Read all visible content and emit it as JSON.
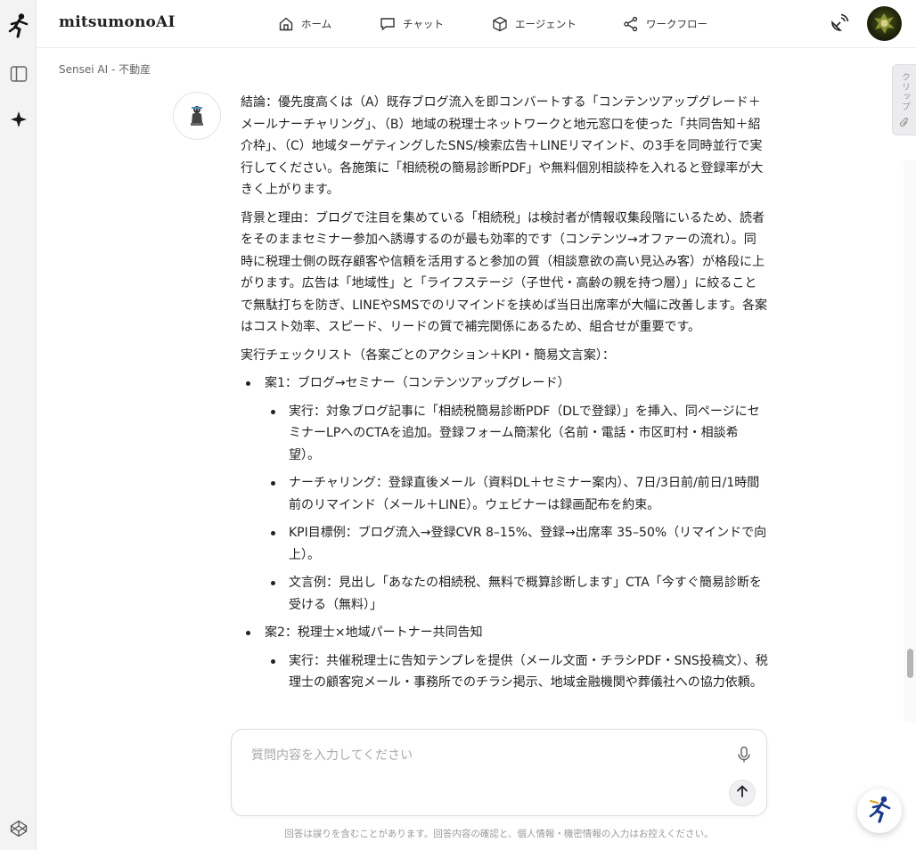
{
  "app": {
    "name": "mitsumonoAI"
  },
  "nav": [
    {
      "label": "ホーム",
      "icon": "home-icon"
    },
    {
      "label": "チャット",
      "icon": "chat-icon"
    },
    {
      "label": "エージェント",
      "icon": "cube-icon"
    },
    {
      "label": "ワークフロー",
      "icon": "share-nodes-icon"
    }
  ],
  "breadcrumb": "Sensei AI - 不動産",
  "clip_tab": {
    "label": "クリップ"
  },
  "message": {
    "p1": "結論：優先度高くは（A）既存ブログ流入を即コンバートする「コンテンツアップグレード＋メールナーチャリング」、（B）地域の税理士ネットワークと地元窓口を使った「共同告知＋紹介枠」、（C）地域ターゲティングしたSNS/検索広告＋LINEリマインド、の3手を同時並行で実行してください。各施策に「相続税の簡易診断PDF」や無料個別相談枠を入れると登録率が大きく上がります。",
    "p2": "背景と理由：ブログで注目を集めている「相続税」は検討者が情報収集段階にいるため、読者をそのままセミナー参加へ誘導するのが最も効率的です（コンテンツ→オファーの流れ）。同時に税理士側の既存顧客や信頼を活用すると参加の質（相談意欲の高い見込み客）が格段に上がります。広告は「地域性」と「ライフステージ（子世代・高齢の親を持つ層）」に絞ることで無駄打ちを防ぎ、LINEやSMSでのリマインドを挟めば当日出席率が大幅に改善します。各案はコスト効率、スピード、リードの質で補完関係にあるため、組合せが重要です。",
    "p3": "実行チェックリスト（各案ごとのアクション＋KPI・簡易文言案）：",
    "plan1": {
      "title": "案1：ブログ→セミナー（コンテンツアップグレード）",
      "items": [
        "実行：対象ブログ記事に「相続税簡易診断PDF（DLで登録）」を挿入、同ページにセミナーLPへのCTAを追加。登録フォーム簡潔化（名前・電話・市区町村・相談希望）。",
        "ナーチャリング：登録直後メール（資料DL＋セミナー案内）、7日/3日前/前日/1時間前のリマインド（メール＋LINE）。ウェビナーは録画配布を約束。",
        "KPI目標例：ブログ流入→登録CVR 8–15%、登録→出席率 35–50%（リマインドで向上）。",
        "文言例：見出し「あなたの相続税、無料で概算診断します」CTA「今すぐ簡易診断を受ける（無料）」"
      ]
    },
    "plan2": {
      "title": "案2：税理士×地域パートナー共同告知",
      "items": [
        "実行：共催税理士に告知テンプレを提供（メール文面・チラシPDF・SNS投稿文）、税理士の顧客宛メール・事務所でのチラシ掲示、地域金融機関や葬儀社への協力依頼。"
      ]
    }
  },
  "input": {
    "placeholder": "質問内容を入力してください",
    "value": ""
  },
  "disclaimer": "回答は誤りを含むことがあります。回答内容の確認と、個人情報・機密情報の入力はお控えください。",
  "colors": {
    "accent": "#1f1f1f",
    "rail_bg": "#f3f3f4",
    "muted": "#9a9a9e"
  }
}
